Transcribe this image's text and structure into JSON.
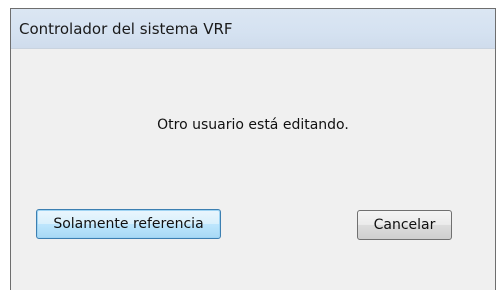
{
  "dialog": {
    "title": "Controlador del sistema VRF",
    "message": "Otro usuario está editando.",
    "buttons": {
      "reference_label": "Solamente referencia",
      "cancel_label": "Cancelar"
    }
  }
}
